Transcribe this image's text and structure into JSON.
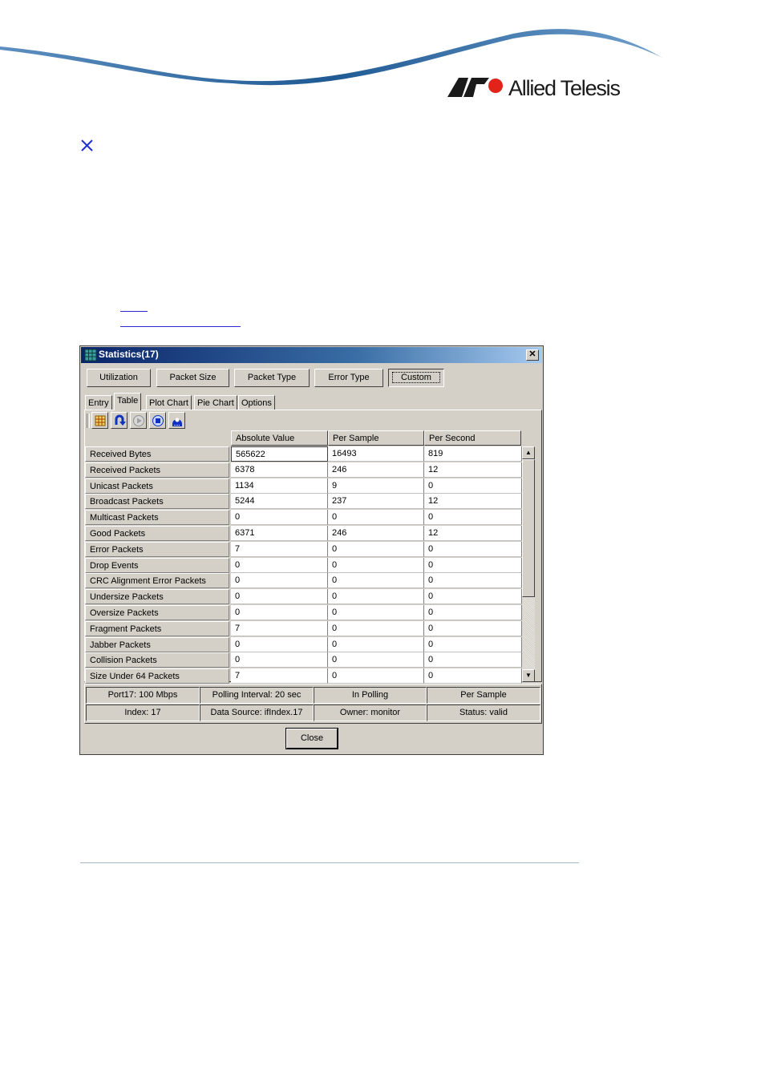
{
  "brand": {
    "name": "Allied Telesis",
    "logo_text": "AT"
  },
  "dialog": {
    "title": "Statistics(17)",
    "close_glyph": "✕",
    "category_buttons": [
      "Utilization",
      "Packet Size",
      "Packet Type",
      "Error Type",
      "Custom"
    ],
    "active_category": "Custom",
    "tabs": [
      "Entry",
      "Table",
      "Plot Chart",
      "Pie Chart",
      "Options"
    ],
    "active_tab": "Table",
    "toolbar_icons": [
      "table-grid-icon",
      "refresh-icon",
      "play-icon",
      "stop-icon",
      "polling-icon"
    ],
    "columns": [
      "Absolute Value",
      "Per Sample",
      "Per Second"
    ],
    "rows": [
      {
        "label": "Received Bytes",
        "values": [
          "565622",
          "16493",
          "819"
        ]
      },
      {
        "label": "Received Packets",
        "values": [
          "6378",
          "246",
          "12"
        ]
      },
      {
        "label": "Unicast Packets",
        "values": [
          "1134",
          "9",
          "0"
        ]
      },
      {
        "label": "Broadcast Packets",
        "values": [
          "5244",
          "237",
          "12"
        ]
      },
      {
        "label": "Multicast Packets",
        "values": [
          "0",
          "0",
          "0"
        ]
      },
      {
        "label": "Good Packets",
        "values": [
          "6371",
          "246",
          "12"
        ]
      },
      {
        "label": "Error Packets",
        "values": [
          "7",
          "0",
          "0"
        ]
      },
      {
        "label": "Drop Events",
        "values": [
          "0",
          "0",
          "0"
        ]
      },
      {
        "label": "CRC Alignment Error Packets",
        "values": [
          "0",
          "0",
          "0"
        ]
      },
      {
        "label": "Undersize Packets",
        "values": [
          "0",
          "0",
          "0"
        ]
      },
      {
        "label": "Oversize Packets",
        "values": [
          "0",
          "0",
          "0"
        ]
      },
      {
        "label": "Fragment Packets",
        "values": [
          "7",
          "0",
          "0"
        ]
      },
      {
        "label": "Jabber Packets",
        "values": [
          "0",
          "0",
          "0"
        ]
      },
      {
        "label": "Collision Packets",
        "values": [
          "0",
          "0",
          "0"
        ]
      },
      {
        "label": "Size Under 64 Packets",
        "values": [
          "7",
          "0",
          "0"
        ]
      }
    ],
    "status": [
      [
        "Port17: 100 Mbps",
        "Polling Interval: 20 sec",
        "In Polling",
        "Per Sample"
      ],
      [
        "Index: 17",
        "Data Source: ifIndex.17",
        "Owner: monitor",
        "Status: valid"
      ]
    ],
    "close_label": "Close"
  },
  "colors": {
    "title_bar": "#0a246a",
    "dialog_face": "#d4d0c8",
    "brand_red": "#e2231a",
    "swoosh": "#1f5a93"
  }
}
